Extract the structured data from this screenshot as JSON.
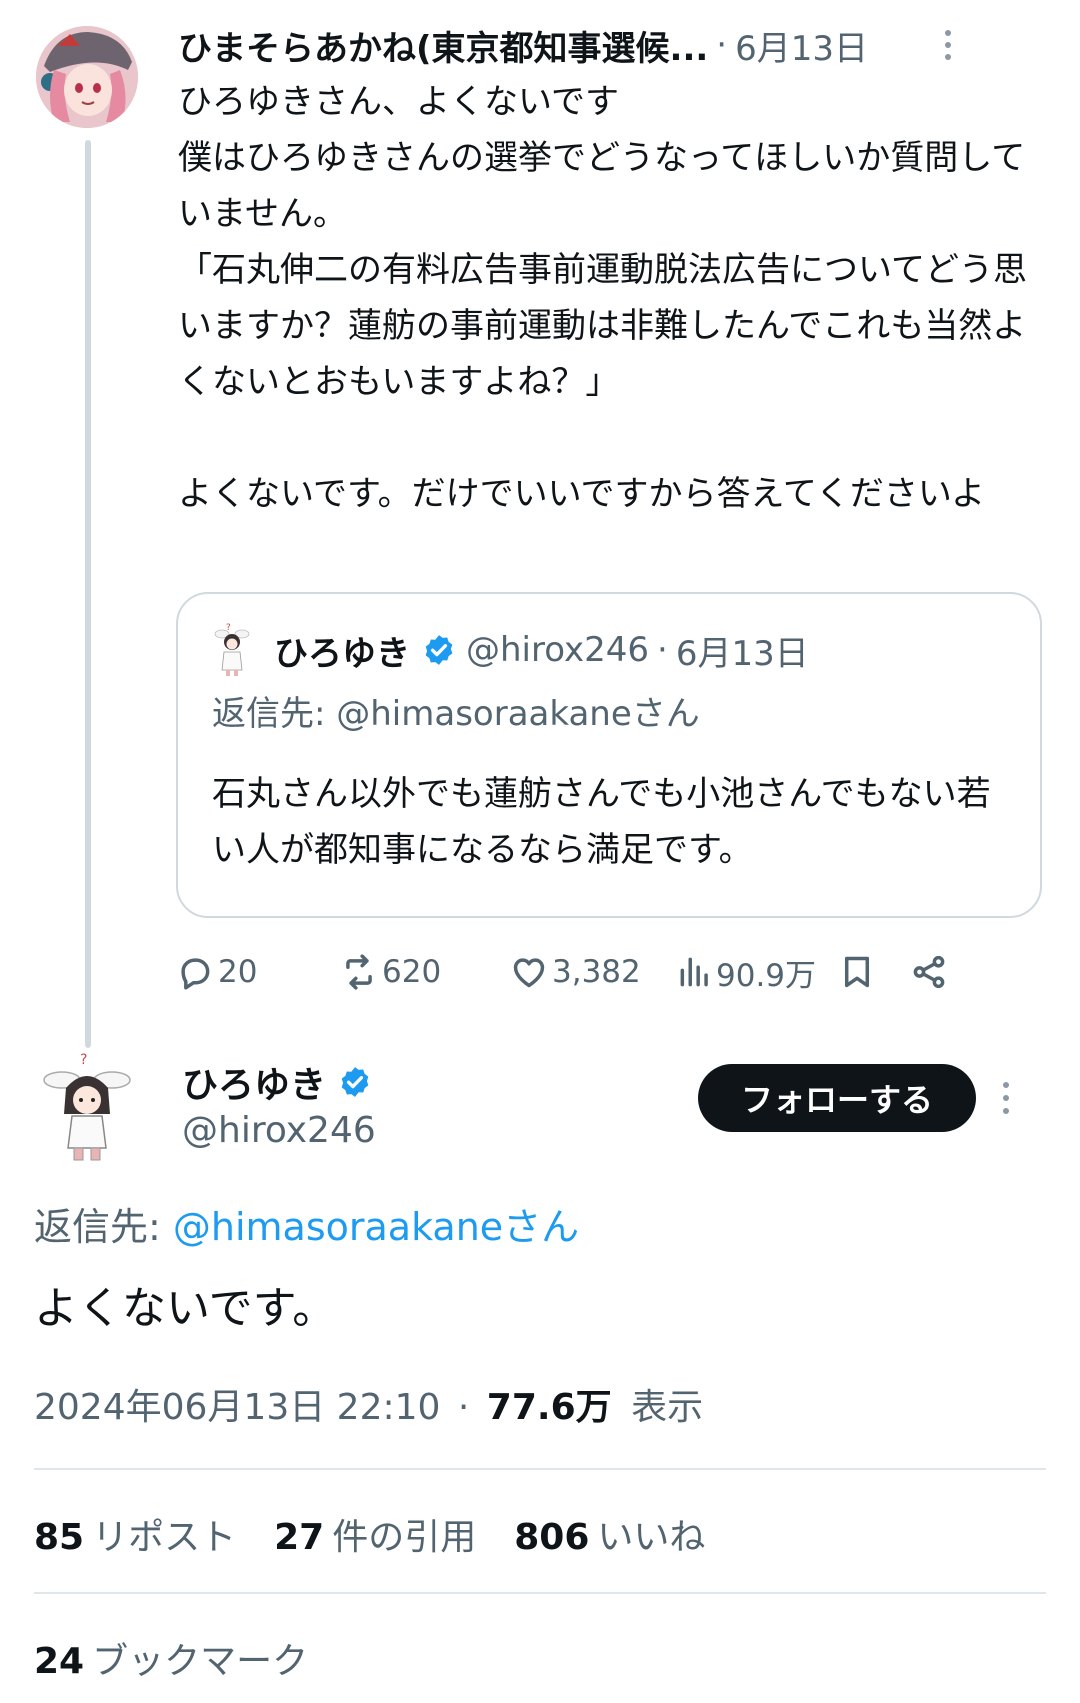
{
  "parent_tweet": {
    "author_name": "ひまそらあかね(東京都知事選候...",
    "separator": "·",
    "date": "6月13日",
    "text": "ひろゆきさん、よくないです\n僕はひろゆきさんの選挙でどうなってほしいか質問していません。\n「石丸伸二の有料広告事前運動脱法広告についてどう思いますか？蓮舫の事前運動は非難したんでこれも当然よくないとおもいますよね？」\n\nよくないです。だけでいいですから答えてくださいよ",
    "quote": {
      "author_name": "ひろゆき",
      "handle": "@hirox246",
      "separator": "·",
      "date": "6月13日",
      "reply_to": "返信先: @himasoraakaneさん",
      "text": "石丸さん以外でも蓮舫さんでも小池さんでもない若い人が都知事になるなら満足です。"
    },
    "actions": {
      "replies": "20",
      "reposts": "620",
      "likes": "3,382",
      "views": "90.9万"
    }
  },
  "main_tweet": {
    "author_name": "ひろゆき",
    "handle": "@hirox246",
    "follow_label": "フォローする",
    "reply_prefix": "返信先: ",
    "reply_handle": "@himasoraakaneさん",
    "text": "よくないです。",
    "timestamp": "2024年06月13日 22:10",
    "separator": "·",
    "views_count": "77.6万",
    "views_label": "表示",
    "stats": {
      "reposts_count": "85",
      "reposts_label": "リポスト",
      "quotes_count": "27",
      "quotes_label": "件の引用",
      "likes_count": "806",
      "likes_label": "いいね",
      "bookmarks_count": "24",
      "bookmarks_label": "ブックマーク"
    }
  },
  "icons": [
    "verified-badge-icon",
    "more-icon",
    "reply-icon",
    "repost-icon",
    "like-icon",
    "views-icon",
    "bookmark-icon",
    "share-icon"
  ],
  "colors": {
    "link": "#1d9bf0",
    "secondary_text": "#536471",
    "primary_text": "#0f1419",
    "button_bg": "#0f1419",
    "divider": "#e1e6ea"
  }
}
